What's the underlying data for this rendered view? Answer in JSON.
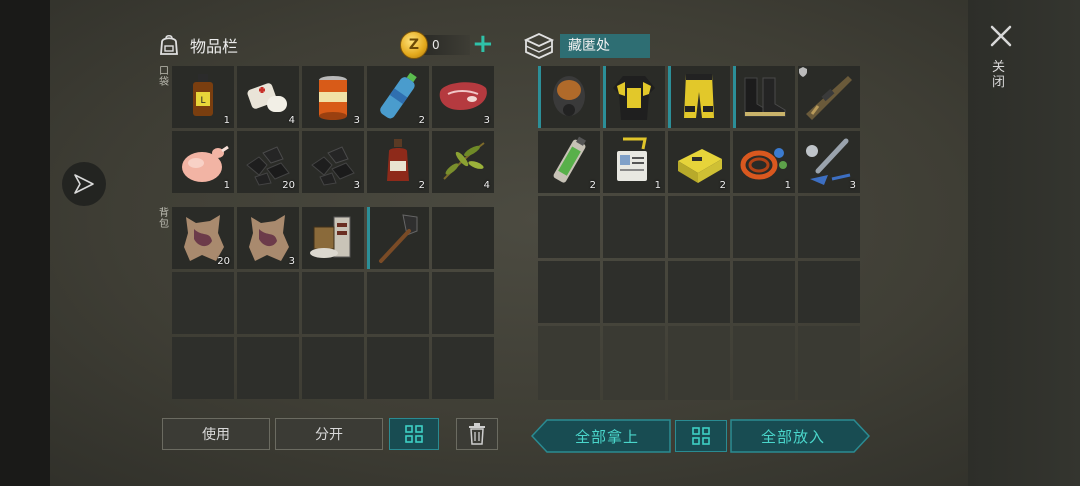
{
  "inventory": {
    "title": "物品栏",
    "coins": "0",
    "add_symbol": "+",
    "pocket_label": "口袋",
    "backpack_label": "背包",
    "pocket_items": [
      {
        "icon": "medicine-bottle-icon",
        "qty": "1"
      },
      {
        "icon": "bandage-icon",
        "qty": "4"
      },
      {
        "icon": "canned-food-icon",
        "qty": "3"
      },
      {
        "icon": "water-bottle-icon",
        "qty": "2"
      },
      {
        "icon": "raw-meat-icon",
        "qty": "3"
      },
      {
        "icon": "raw-chicken-icon",
        "qty": "1"
      },
      {
        "icon": "coal-icon",
        "qty": "20"
      },
      {
        "icon": "coal-icon",
        "qty": "3"
      },
      {
        "icon": "red-potion-bottle-icon",
        "qty": "2"
      },
      {
        "icon": "plant-fiber-icon",
        "qty": "4"
      }
    ],
    "backpack_items": [
      {
        "icon": "animal-hide-icon",
        "qty": "20"
      },
      {
        "icon": "animal-hide-icon",
        "qty": "3"
      },
      {
        "icon": "scrap-parts-icon",
        "qty": ""
      },
      {
        "icon": "shovel-icon",
        "qty": ""
      }
    ],
    "buttons": {
      "use": "使用",
      "split": "分开",
      "sort": "sort-grid-icon",
      "trash": "trash-icon"
    }
  },
  "stash": {
    "title": "藏匿处",
    "items": [
      {
        "icon": "gas-mask-icon",
        "qty": ""
      },
      {
        "icon": "hazmat-jacket-icon",
        "qty": ""
      },
      {
        "icon": "hazmat-pants-icon",
        "qty": ""
      },
      {
        "icon": "boots-icon",
        "qty": ""
      },
      {
        "icon": "rifle-icon",
        "qty": ""
      },
      {
        "icon": "battery-cell-icon",
        "qty": "2"
      },
      {
        "icon": "id-card-icon",
        "qty": "1"
      },
      {
        "icon": "power-unit-icon",
        "qty": "2"
      },
      {
        "icon": "cable-coil-icon",
        "qty": "1"
      },
      {
        "icon": "wire-parts-icon",
        "qty": "3"
      }
    ],
    "buttons": {
      "take_all": "全部拿上",
      "put_all": "全部放入",
      "sort": "sort-grid-icon"
    }
  },
  "close_label": "关闭",
  "colors": {
    "accent": "#2fc1a8",
    "teal_button": "#184c52",
    "stash_title_bg": "#2e6e73"
  }
}
